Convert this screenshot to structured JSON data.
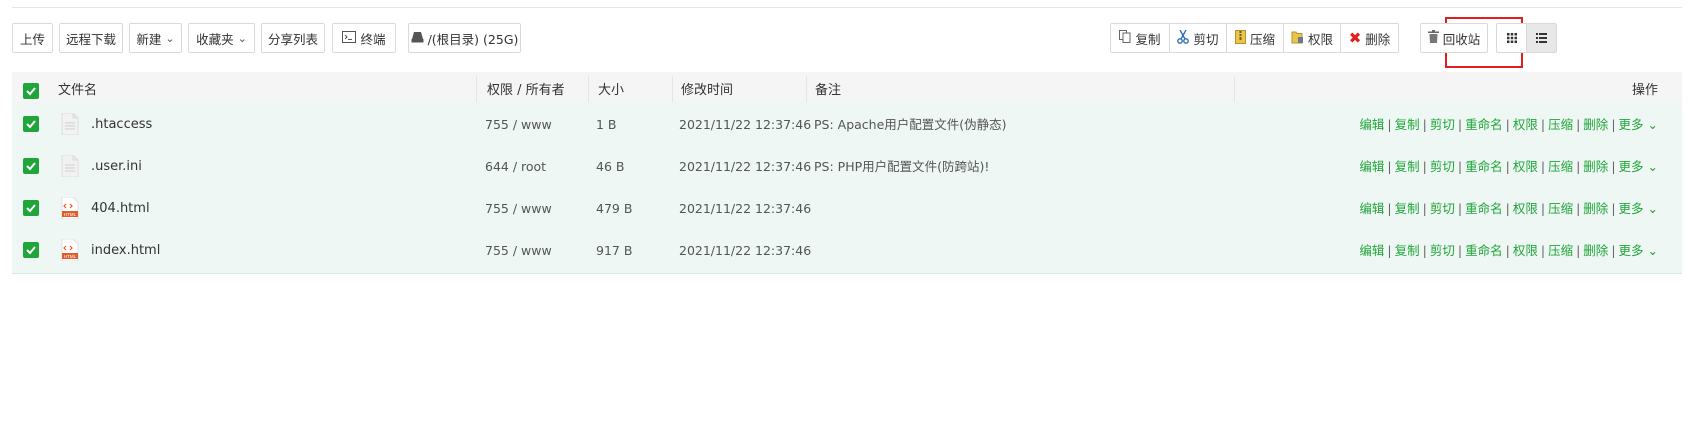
{
  "toolbar": {
    "upload": "上传",
    "remote_download": "远程下载",
    "new": "新建",
    "favorites": "收藏夹",
    "share_list": "分享列表",
    "terminal": "终端",
    "path": "/(根目录) (25G)",
    "copy": "复制",
    "cut": "剪切",
    "compress": "压缩",
    "permission": "权限",
    "delete": "删除",
    "recycle_bin": "回收站"
  },
  "table": {
    "headers": {
      "name": "文件名",
      "perm_owner": "权限 / 所有者",
      "size": "大小",
      "mtime": "修改时间",
      "note": "备注",
      "actions": "操作"
    },
    "rows": [
      {
        "name": ".htaccess",
        "perm": "755 / www",
        "size": "1 B",
        "mtime": "2021/11/22 12:37:46",
        "note": "PS: Apache用户配置文件(伪静态)",
        "icon": "text-file-icon"
      },
      {
        "name": ".user.ini",
        "perm": "644 / root",
        "size": "46 B",
        "mtime": "2021/11/22 12:37:46",
        "note": "PS: PHP用户配置文件(防跨站)!",
        "icon": "text-file-icon"
      },
      {
        "name": "404.html",
        "perm": "755 / www",
        "size": "479 B",
        "mtime": "2021/11/22 12:37:46",
        "note": "",
        "icon": "html-file-icon"
      },
      {
        "name": "index.html",
        "perm": "755 / www",
        "size": "917 B",
        "mtime": "2021/11/22 12:37:46",
        "note": "",
        "icon": "html-file-icon"
      }
    ],
    "row_actions": {
      "edit": "编辑",
      "copy": "复制",
      "cut": "剪切",
      "rename": "重命名",
      "permission": "权限",
      "compress": "压缩",
      "delete": "删除",
      "more": "更多"
    }
  },
  "colors": {
    "accent_green": "#20a53a",
    "row_bg": "#eef7f3",
    "highlight_red": "#e02020"
  }
}
